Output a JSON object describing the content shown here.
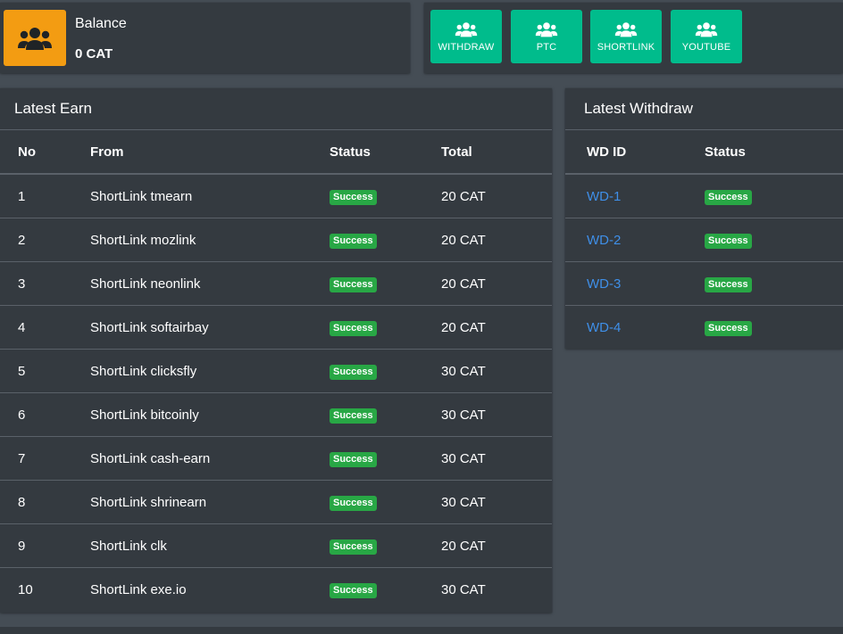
{
  "balance": {
    "icon": "users-icon",
    "label": "Balance",
    "value": "0 CAT",
    "accent_color": "#f39c12"
  },
  "actions": [
    {
      "label": "WITHDRAW",
      "icon": "users-icon"
    },
    {
      "label": "PTC",
      "icon": "users-icon"
    },
    {
      "label": "SHORTLINK",
      "icon": "users-icon"
    },
    {
      "label": "YOUTUBE",
      "icon": "users-icon"
    }
  ],
  "action_color": "#00bc8c",
  "latest_earn": {
    "title": "Latest Earn",
    "columns": [
      "No",
      "From",
      "Status",
      "Total"
    ],
    "rows": [
      {
        "no": "1",
        "from": "ShortLink tmearn",
        "status": "Success",
        "total": "20 CAT"
      },
      {
        "no": "2",
        "from": "ShortLink mozlink",
        "status": "Success",
        "total": "20 CAT"
      },
      {
        "no": "3",
        "from": "ShortLink neonlink",
        "status": "Success",
        "total": "20 CAT"
      },
      {
        "no": "4",
        "from": "ShortLink softairbay",
        "status": "Success",
        "total": "20 CAT"
      },
      {
        "no": "5",
        "from": "ShortLink clicksfly",
        "status": "Success",
        "total": "30 CAT"
      },
      {
        "no": "6",
        "from": "ShortLink bitcoinly",
        "status": "Success",
        "total": "30 CAT"
      },
      {
        "no": "7",
        "from": "ShortLink cash-earn",
        "status": "Success",
        "total": "30 CAT"
      },
      {
        "no": "8",
        "from": "ShortLink shrinearn",
        "status": "Success",
        "total": "30 CAT"
      },
      {
        "no": "9",
        "from": "ShortLink clk",
        "status": "Success",
        "total": "20 CAT"
      },
      {
        "no": "10",
        "from": "ShortLink exe.io",
        "status": "Success",
        "total": "30 CAT"
      }
    ]
  },
  "latest_withdraw": {
    "title": "Latest Withdraw",
    "columns": [
      "WD ID",
      "Status"
    ],
    "rows": [
      {
        "id": "WD-1",
        "status": "Success"
      },
      {
        "id": "WD-2",
        "status": "Success"
      },
      {
        "id": "WD-3",
        "status": "Success"
      },
      {
        "id": "WD-4",
        "status": "Success"
      }
    ]
  },
  "status_color": "#28a745",
  "link_color": "#3f8fe8"
}
